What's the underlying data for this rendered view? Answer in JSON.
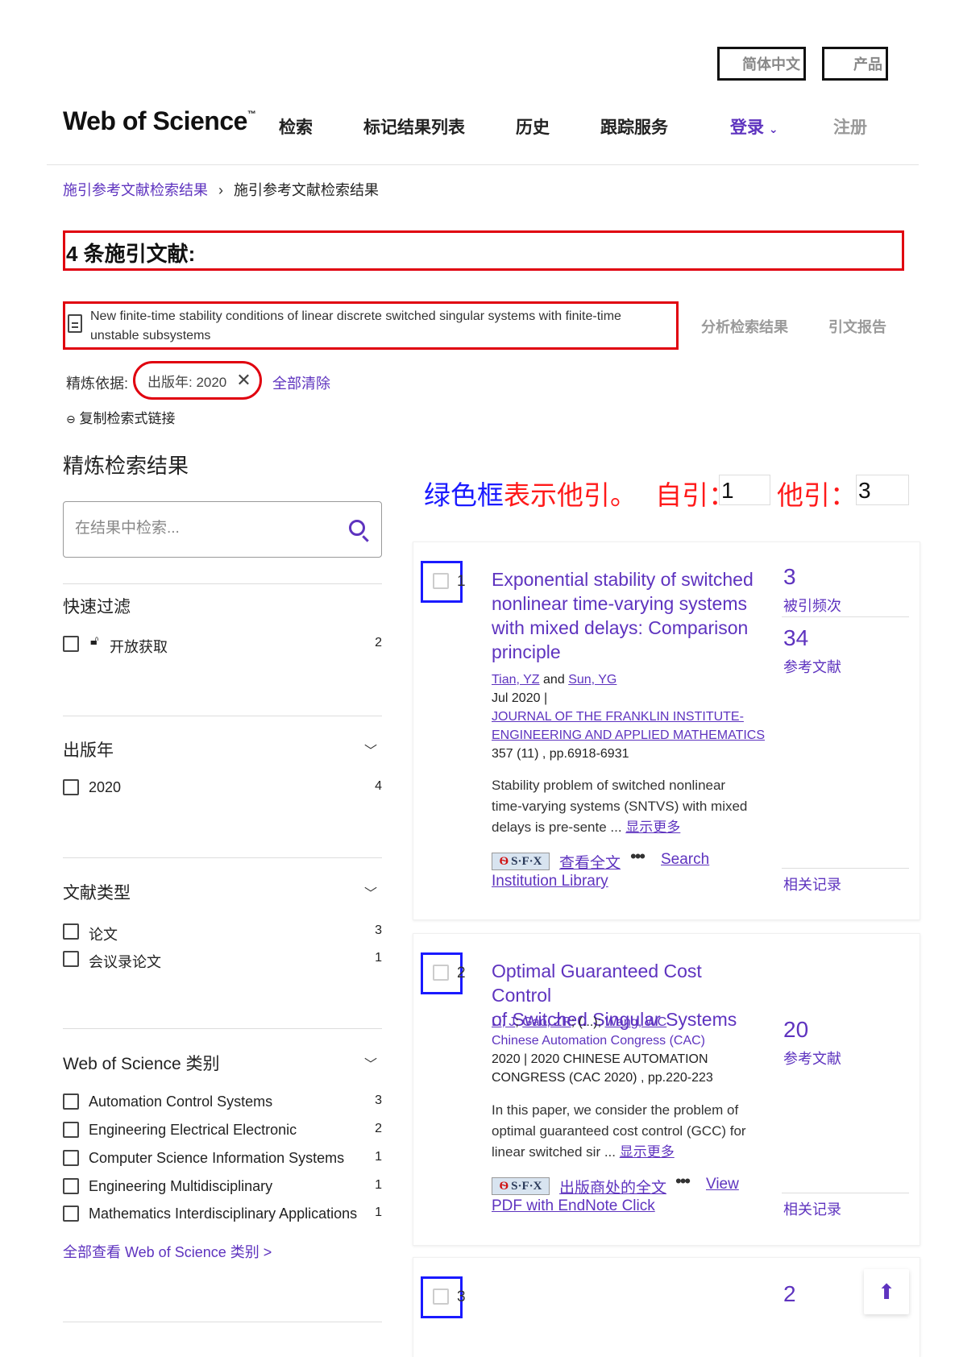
{
  "top": {
    "lang_label": "简体中文",
    "products_label": "产品"
  },
  "header": {
    "brand": "Web of Science",
    "brand_tm": "™",
    "nav": [
      "检索",
      "标记结果列表",
      "历史",
      "跟踪服务"
    ],
    "login": "登录",
    "register": "注册"
  },
  "breadcrumb": {
    "parent": "施引参考文献检索结果",
    "sep": "›",
    "current": "施引参考文献检索结果"
  },
  "results_title": "4 条施引文献:",
  "query_text": "New finite-time stability conditions of linear discrete switched singular systems with finite-time unstable subsystems",
  "actions": {
    "analyze": "分析检索结果",
    "citation_report": "引文报告"
  },
  "refine": {
    "label": "精炼依据:",
    "chip": "出版年: 2020",
    "clear_all": "全部清除",
    "copy_link": "复制检索式链接"
  },
  "sidebar": {
    "title": "精炼检索结果",
    "search_placeholder": "在结果中检索...",
    "quick_filter": {
      "title": "快速过滤",
      "items": [
        {
          "label": "开放获取",
          "count": "2"
        }
      ]
    },
    "pub_year": {
      "title": "出版年",
      "items": [
        {
          "label": "2020",
          "count": "4"
        }
      ]
    },
    "doc_type": {
      "title": "文献类型",
      "items": [
        {
          "label": "论文",
          "count": "3"
        },
        {
          "label": "会议录论文",
          "count": "1"
        }
      ]
    },
    "wos_categories": {
      "title": "Web of Science 类别",
      "items": [
        {
          "label": "Automation Control Systems",
          "count": "3"
        },
        {
          "label": "Engineering Electrical Electronic",
          "count": "2"
        },
        {
          "label": "Computer Science Information Systems",
          "count": "1"
        },
        {
          "label": "Engineering Multidisciplinary",
          "count": "1"
        },
        {
          "label": "Mathematics Interdisciplinary Applications",
          "count": "1"
        }
      ],
      "see_all": "全部查看 Web of Science 类别 >"
    }
  },
  "annotation": {
    "part1": "绿色框",
    "part2": "表示他引。",
    "self_label": "自引：",
    "self_value": "1",
    "other_label": "他引：",
    "other_value": "3",
    "colors": {
      "blue": "#1a1aff",
      "red": "#ff1a1a",
      "box_red": "#e0000f"
    }
  },
  "results": [
    {
      "num": "1",
      "title_lines": [
        "Exponential stability of switched",
        "nonlinear time-varying systems",
        "with mixed delays: Comparison",
        "principle"
      ],
      "author1": "Tian, YZ",
      "and": "and",
      "author2": "Sun, YG",
      "date": "Jul 2020 |",
      "journal1": "JOURNAL OF THE FRANKLIN INSTITUTE-",
      "journal2": "ENGINEERING AND APPLIED MATHEMATICS",
      "pages": "357 (11) , pp.6918-6931",
      "abstract1": "Stability problem of switched nonlinear",
      "abstract2": "time-varying systems (SNTVS) with mixed",
      "abstract3": "delays is pre-sente ...",
      "show_more": "显示更多",
      "sfx": "S·F·X",
      "fulltext": "查看全文",
      "more": "•••",
      "search1": "Search",
      "search2": "Institution Library",
      "cited_count": "3",
      "cited_label": "被引频次",
      "ref_count": "34",
      "ref_label": "参考文献",
      "related": "相关记录"
    },
    {
      "num": "2",
      "title_lines": [
        "Optimal Guaranteed Cost Control",
        "of Switched Singular Systems"
      ],
      "author1": "Li, J",
      "author2": "Gao, ZR",
      "ellipsis": "(...)",
      "author3": "Wang, WC",
      "conference": "Chinese Automation Congress (CAC)",
      "proc1": "2020 | 2020 CHINESE AUTOMATION",
      "proc2": "CONGRESS (CAC 2020) , pp.220-223",
      "abstract1": "In this paper, we consider the problem of",
      "abstract2": "optimal guaranteed cost control (GCC) for",
      "abstract3": "linear switched sir ...",
      "show_more": "显示更多",
      "sfx": "S·F·X",
      "fulltext": "出版商处的全文",
      "more": "•••",
      "view1": "View",
      "view2": "PDF with EndNote Click",
      "ref_count": "20",
      "ref_label": "参考文献",
      "related": "相关记录"
    },
    {
      "num": "3",
      "ref_count": "2"
    }
  ],
  "icons": [
    "document-icon",
    "search-icon",
    "lock-icon",
    "chevron-down-icon",
    "close-icon",
    "link-icon",
    "arrow-up-icon"
  ]
}
